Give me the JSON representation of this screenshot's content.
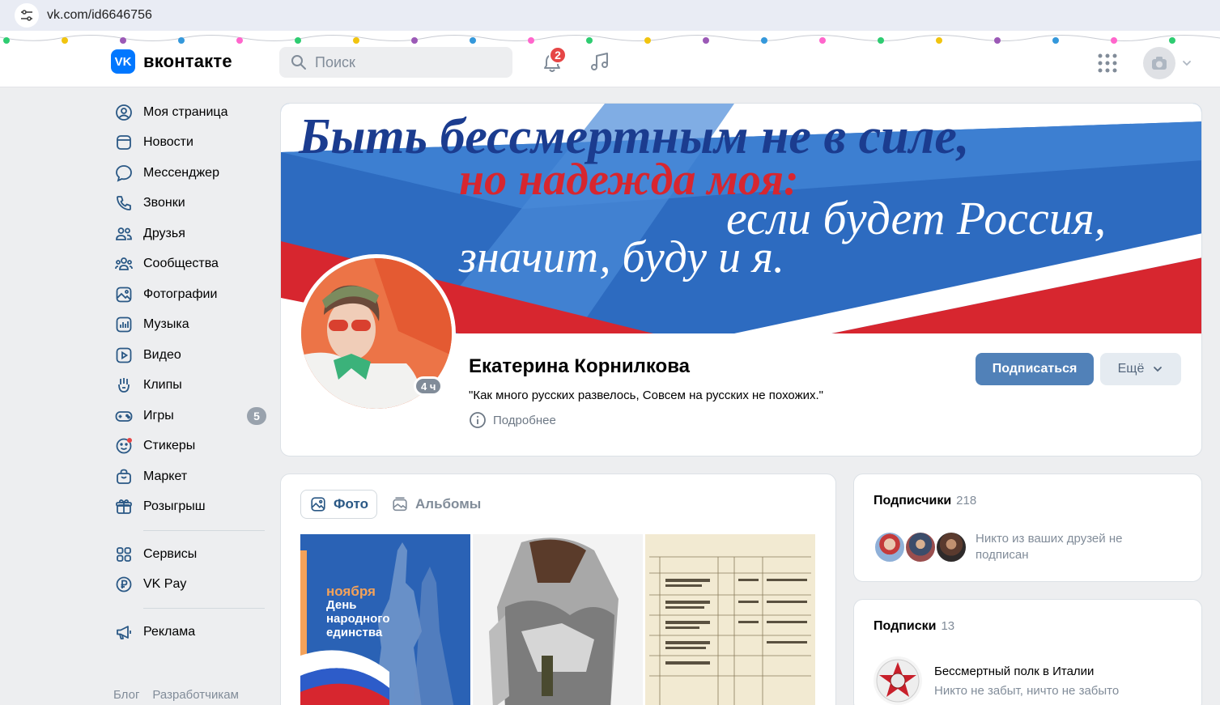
{
  "browser": {
    "url": "vk.com/id6646756"
  },
  "header": {
    "logo_text": "вконтакте",
    "logo_mark": "VK",
    "search_placeholder": "Поиск",
    "notifications_count": "2"
  },
  "nav": {
    "items": [
      {
        "label": "Моя страница",
        "icon": "user-circle-icon"
      },
      {
        "label": "Новости",
        "icon": "news-icon"
      },
      {
        "label": "Мессенджер",
        "icon": "message-icon"
      },
      {
        "label": "Звонки",
        "icon": "phone-icon"
      },
      {
        "label": "Друзья",
        "icon": "friends-icon"
      },
      {
        "label": "Сообщества",
        "icon": "communities-icon"
      },
      {
        "label": "Фотографии",
        "icon": "photo-icon"
      },
      {
        "label": "Музыка",
        "icon": "music-icon"
      },
      {
        "label": "Видео",
        "icon": "video-icon"
      },
      {
        "label": "Клипы",
        "icon": "clips-icon"
      },
      {
        "label": "Игры",
        "icon": "games-icon",
        "badge": "5"
      },
      {
        "label": "Стикеры",
        "icon": "stickers-icon"
      },
      {
        "label": "Маркет",
        "icon": "market-icon"
      },
      {
        "label": "Розыгрыш",
        "icon": "gift-icon"
      }
    ],
    "extra": [
      {
        "label": "Сервисы",
        "icon": "services-icon"
      },
      {
        "label": "VK Pay",
        "icon": "vkpay-icon"
      }
    ],
    "ads": {
      "label": "Реклама",
      "icon": "megaphone-icon"
    },
    "footer": [
      "Блог",
      "Разработчикам"
    ]
  },
  "profile": {
    "cover_lines": [
      "Быть бессмертным не в силе,",
      "но надежда моя:",
      "если будет Россия,",
      "значит, буду и я."
    ],
    "online": "4 ч",
    "name": "Екатерина Корнилкова",
    "status": "\"Как много русских развелось, Совсем на русских не похожих.\"",
    "more_label": "Подробнее",
    "subscribe_label": "Подписаться",
    "more_button_label": "Ещё"
  },
  "photos": {
    "tab_photo": "Фото",
    "tab_albums": "Альбомы",
    "photo1_text": {
      "month": "ноября",
      "line1": "День",
      "line2": "народного",
      "line3": "единства"
    }
  },
  "subscribers": {
    "title": "Подписчики",
    "count": "218",
    "note": "Никто из ваших друзей не подписан"
  },
  "following": {
    "title": "Подписки",
    "count": "13",
    "group_name": "Бессмертный полк в Италии",
    "group_desc": "Никто не забыт, ничто не забыто"
  },
  "colors": {
    "brand": "#0077ff",
    "subscribe_button": "#5181b8",
    "notification_badge": "#e64646",
    "icon_blue": "#2a5885"
  }
}
